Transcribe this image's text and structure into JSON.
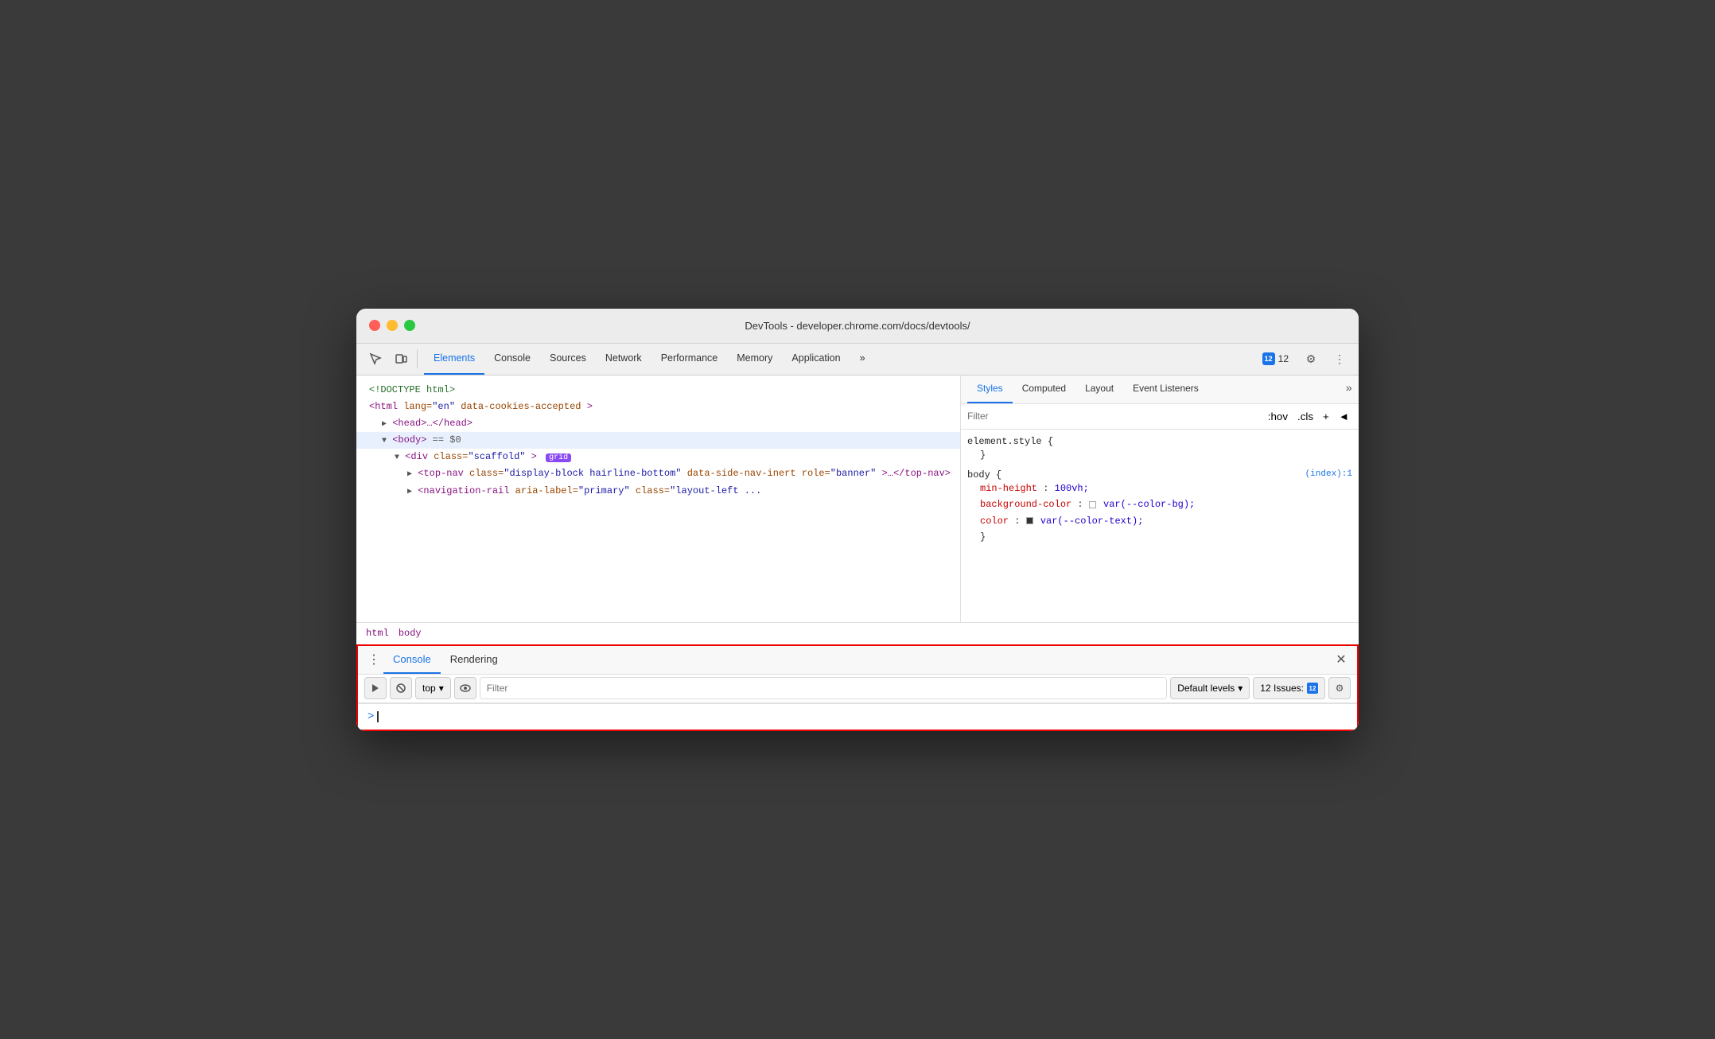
{
  "window": {
    "title": "DevTools - developer.chrome.com/docs/devtools/"
  },
  "toolbar": {
    "tabs": [
      "Elements",
      "Console",
      "Sources",
      "Network",
      "Performance",
      "Memory",
      "Application"
    ],
    "active_tab": "Elements",
    "more_tabs_label": "»",
    "issues_count": "12",
    "issues_label": "12"
  },
  "dom": {
    "lines": [
      {
        "indent": 0,
        "content": "<!DOCTYPE html>"
      },
      {
        "indent": 0,
        "content": "<html lang=\"en\" data-cookies-accepted>"
      },
      {
        "indent": 1,
        "content": "▶ <head>…</head>"
      },
      {
        "indent": 1,
        "content": "▼ <body> == $0",
        "selected": true
      },
      {
        "indent": 2,
        "content": "▼ <div class=\"scaffold\"> grid"
      },
      {
        "indent": 3,
        "content": "▶ <top-nav class=\"display-block hairline-bottom\" data-side-nav-inert role=\"banner\">…</top-nav>"
      },
      {
        "indent": 3,
        "content": "▶ <navigation-rail aria-label=\"primary\" class=\"layout-left ..."
      }
    ]
  },
  "breadcrumbs": [
    "html",
    "body"
  ],
  "styles_panel": {
    "tabs": [
      "Styles",
      "Computed",
      "Layout",
      "Event Listeners"
    ],
    "active_tab": "Styles",
    "more_label": "»",
    "filter_placeholder": "Filter",
    "filter_hov": ":hov",
    "filter_cls": ".cls",
    "filter_plus": "+",
    "filter_arrow": "◄",
    "rules": [
      {
        "selector": "element.style {",
        "closing": "}",
        "source": "",
        "props": []
      },
      {
        "selector": "body {",
        "closing": "}",
        "source": "(index):1",
        "props": [
          {
            "name": "min-height",
            "value": "100vh;"
          },
          {
            "name": "background-color",
            "value": "var(--color-bg);",
            "has_swatch": true
          },
          {
            "name": "color",
            "value": "var(--color-text);",
            "has_swatch_dark": true,
            "truncated": true
          }
        ]
      }
    ]
  },
  "console": {
    "header_tabs": [
      "Console",
      "Rendering"
    ],
    "active_tab": "Console",
    "toolbar": {
      "execute_btn": "▶",
      "clear_btn": "🚫",
      "context_label": "top",
      "context_dropdown": "▾",
      "eye_btn": "👁",
      "filter_placeholder": "Filter",
      "levels_label": "Default levels",
      "levels_dropdown": "▾",
      "issues_label": "12 Issues:",
      "issues_count": "12",
      "settings_label": "⚙"
    },
    "prompt_chevron": ">",
    "input_value": ""
  }
}
